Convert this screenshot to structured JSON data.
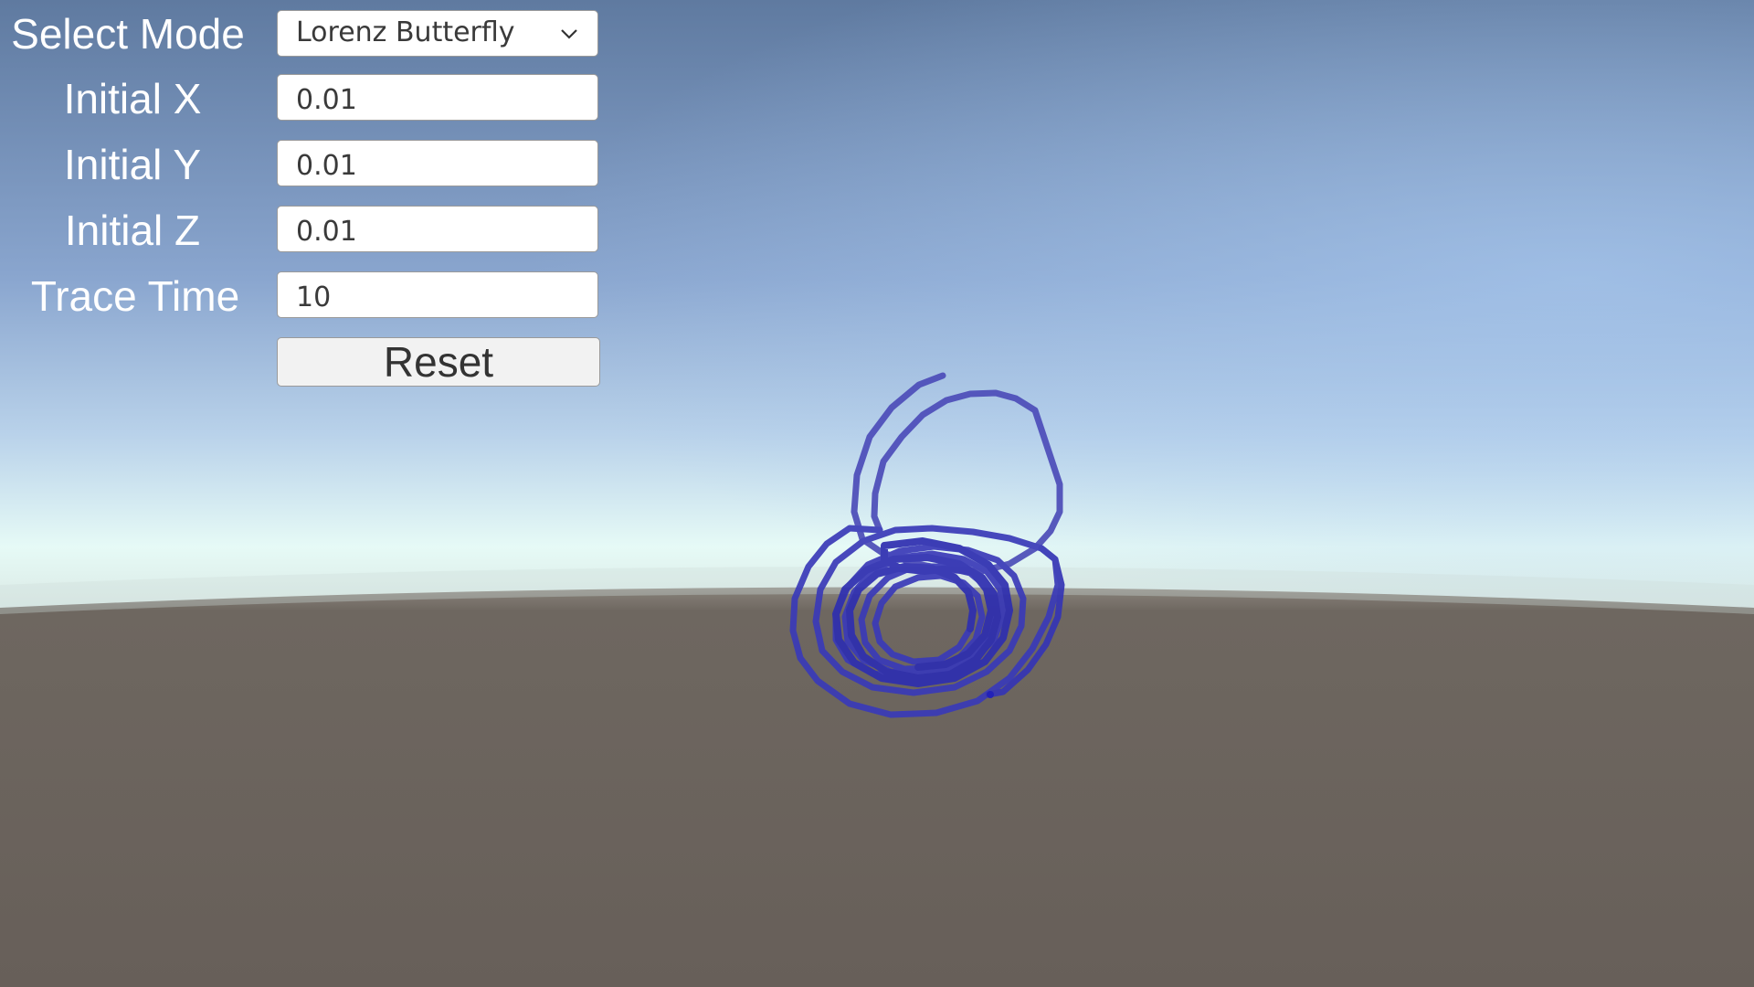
{
  "colors": {
    "sky_top": "#5f7aa0",
    "sky_mid": "#9fb9dc",
    "horizon": "#e6faf6",
    "ground": "#676059",
    "trace": "#3434b0"
  },
  "controls": {
    "mode_label": "Select Mode",
    "mode_value": "Lorenz Butterfly",
    "mode_icon": "chevron-down-icon",
    "initial_x_label": "Initial X",
    "initial_x_value": "0.01",
    "initial_y_label": "Initial Y",
    "initial_y_value": "0.01",
    "initial_z_label": "Initial Z",
    "initial_z_value": "0.01",
    "trace_time_label": "Trace Time",
    "trace_time_value": "10",
    "reset_label": "Reset"
  }
}
